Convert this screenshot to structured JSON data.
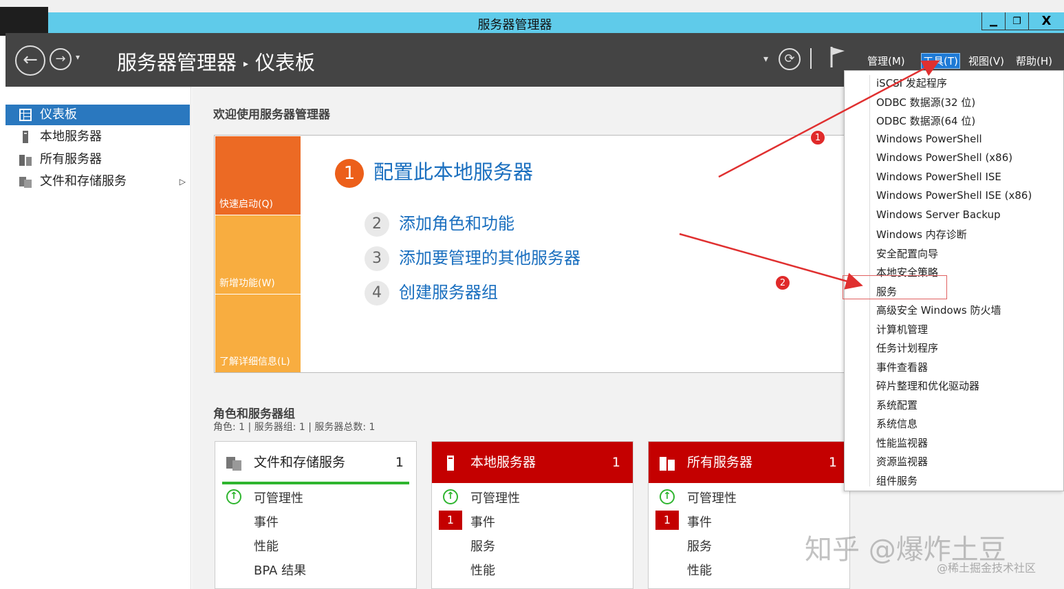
{
  "window": {
    "title": "服务器管理器",
    "minimize": "▁",
    "restore": "❐",
    "close": "X"
  },
  "header": {
    "breadcrumb_app": "服务器管理器",
    "breadcrumb_sep": "▸",
    "breadcrumb_page": "仪表板",
    "menus": [
      "管理(M)",
      "工具(T)",
      "视图(V)",
      "帮助(H)"
    ]
  },
  "sidebar": {
    "items": [
      {
        "label": "仪表板",
        "icon": "dashboard-icon"
      },
      {
        "label": "本地服务器",
        "icon": "server-icon"
      },
      {
        "label": "所有服务器",
        "icon": "servers-icon"
      },
      {
        "label": "文件和存储服务",
        "icon": "storage-icon"
      }
    ],
    "expand_arrow": "▷"
  },
  "main": {
    "welcome": "欢迎使用服务器管理器",
    "tiles": [
      "快速启动(Q)",
      "新增功能(W)",
      "了解详细信息(L)"
    ],
    "step_main": {
      "num": "1",
      "label": "配置此本地服务器"
    },
    "steps": [
      {
        "num": "2",
        "label": "添加角色和功能"
      },
      {
        "num": "3",
        "label": "添加要管理的其他服务器"
      },
      {
        "num": "4",
        "label": "创建服务器组"
      }
    ],
    "roles_title": "角色和服务器组",
    "roles_sub": "角色: 1 | 服务器组: 1 | 服务器总数: 1",
    "cards": [
      {
        "title": "文件和存储服务",
        "count": "1",
        "rows": [
          "可管理性",
          "事件",
          "性能",
          "BPA 结果"
        ]
      },
      {
        "title": "本地服务器",
        "count": "1",
        "rows": [
          "可管理性",
          "事件",
          "服务",
          "性能"
        ],
        "event_badge": "1"
      },
      {
        "title": "所有服务器",
        "count": "1",
        "rows": [
          "可管理性",
          "事件",
          "服务",
          "性能"
        ],
        "event_badge": "1"
      }
    ]
  },
  "tools_menu": {
    "items": [
      "iSCSI 发起程序",
      "ODBC 数据源(32 位)",
      "ODBC 数据源(64 位)",
      "Windows PowerShell",
      "Windows PowerShell (x86)",
      "Windows PowerShell ISE",
      "Windows PowerShell ISE (x86)",
      "Windows Server Backup",
      "Windows 内存诊断",
      "安全配置向导",
      "本地安全策略",
      "服务",
      "高级安全 Windows 防火墙",
      "计算机管理",
      "任务计划程序",
      "事件查看器",
      "碎片整理和优化驱动器",
      "系统配置",
      "系统信息",
      "性能监视器",
      "资源监视器",
      "组件服务"
    ]
  },
  "annotations": {
    "dot1": "1",
    "dot2": "2",
    "arrow_color": "#e03030"
  },
  "watermark": {
    "main": "知乎 @爆炸土豆",
    "sub": "@稀土掘金技术社区"
  },
  "colors": {
    "titlebar": "#5fcbea",
    "header": "#444444",
    "accent_blue": "#2a78bf",
    "orange": "#ec5f1a",
    "alert_red": "#c40000",
    "ok_green": "#2fb52f"
  }
}
